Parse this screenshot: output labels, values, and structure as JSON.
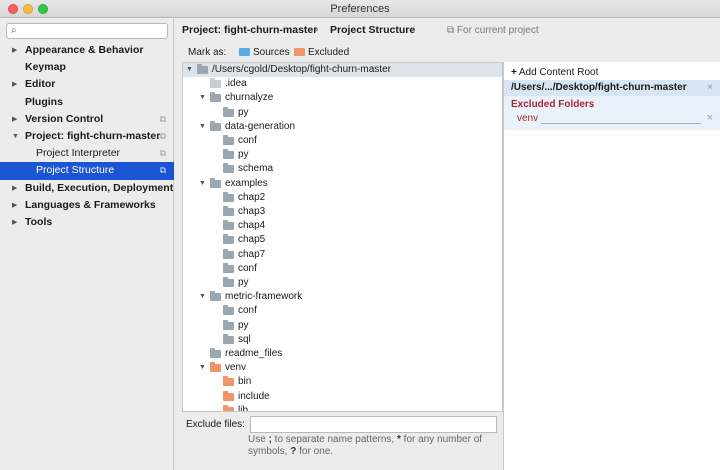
{
  "window": {
    "title": "Preferences"
  },
  "sidebar": {
    "search_placeholder": "",
    "items": [
      {
        "label": "Appearance & Behavior",
        "arrow": "▶",
        "copy": "",
        "sub": false,
        "selected": false
      },
      {
        "label": "Keymap",
        "arrow": "",
        "copy": "",
        "sub": false,
        "selected": false
      },
      {
        "label": "Editor",
        "arrow": "▶",
        "copy": "",
        "sub": false,
        "selected": false
      },
      {
        "label": "Plugins",
        "arrow": "",
        "copy": "",
        "sub": false,
        "selected": false
      },
      {
        "label": "Version Control",
        "arrow": "▶",
        "copy": "⧉",
        "sub": false,
        "selected": false
      },
      {
        "label": "Project: fight-churn-master",
        "arrow": "▼",
        "copy": "⧉",
        "sub": false,
        "selected": false
      },
      {
        "label": "Project Interpreter",
        "arrow": "",
        "copy": "⧉",
        "sub": true,
        "selected": false
      },
      {
        "label": "Project Structure",
        "arrow": "",
        "copy": "⧉",
        "sub": true,
        "selected": true
      },
      {
        "label": "Build, Execution, Deployment",
        "arrow": "▶",
        "copy": "",
        "sub": false,
        "selected": false
      },
      {
        "label": "Languages & Frameworks",
        "arrow": "▶",
        "copy": "",
        "sub": false,
        "selected": false
      },
      {
        "label": "Tools",
        "arrow": "▶",
        "copy": "",
        "sub": false,
        "selected": false
      }
    ]
  },
  "header": {
    "crumb_project": "Project: fight-churn-master",
    "separator": "›",
    "crumb_page": "Project Structure",
    "for_current": "For current project",
    "for_current_icon": "⧉"
  },
  "markas": {
    "label": "Mark as:",
    "sources": "Sources",
    "excluded": "Excluded",
    "sources_color": "#5aa9e6",
    "excluded_color": "#f0946a"
  },
  "tree": [
    {
      "label": "/Users/cgold/Desktop/fight-churn-master",
      "level": 0,
      "arrow": "▼",
      "type": "normal",
      "root": true
    },
    {
      "label": ".idea",
      "level": 1,
      "arrow": "",
      "type": "faint"
    },
    {
      "label": "churnalyze",
      "level": 1,
      "arrow": "▼",
      "type": "normal"
    },
    {
      "label": "py",
      "level": 2,
      "arrow": "",
      "type": "normal"
    },
    {
      "label": "data-generation",
      "level": 1,
      "arrow": "▼",
      "type": "normal"
    },
    {
      "label": "conf",
      "level": 2,
      "arrow": "",
      "type": "normal"
    },
    {
      "label": "py",
      "level": 2,
      "arrow": "",
      "type": "normal"
    },
    {
      "label": "schema",
      "level": 2,
      "arrow": "",
      "type": "normal"
    },
    {
      "label": "examples",
      "level": 1,
      "arrow": "▼",
      "type": "normal"
    },
    {
      "label": "chap2",
      "level": 2,
      "arrow": "",
      "type": "normal"
    },
    {
      "label": "chap3",
      "level": 2,
      "arrow": "",
      "type": "normal"
    },
    {
      "label": "chap4",
      "level": 2,
      "arrow": "",
      "type": "normal"
    },
    {
      "label": "chap5",
      "level": 2,
      "arrow": "",
      "type": "normal"
    },
    {
      "label": "chap7",
      "level": 2,
      "arrow": "",
      "type": "normal"
    },
    {
      "label": "conf",
      "level": 2,
      "arrow": "",
      "type": "normal"
    },
    {
      "label": "py",
      "level": 2,
      "arrow": "",
      "type": "normal"
    },
    {
      "label": "metric-framework",
      "level": 1,
      "arrow": "▼",
      "type": "normal"
    },
    {
      "label": "conf",
      "level": 2,
      "arrow": "",
      "type": "normal"
    },
    {
      "label": "py",
      "level": 2,
      "arrow": "",
      "type": "normal"
    },
    {
      "label": "sql",
      "level": 2,
      "arrow": "",
      "type": "normal"
    },
    {
      "label": "readme_files",
      "level": 1,
      "arrow": "",
      "type": "normal"
    },
    {
      "label": "venv",
      "level": 1,
      "arrow": "▼",
      "type": "excluded"
    },
    {
      "label": "bin",
      "level": 2,
      "arrow": "",
      "type": "excluded"
    },
    {
      "label": "include",
      "level": 2,
      "arrow": "",
      "type": "excluded"
    },
    {
      "label": "lib",
      "level": 2,
      "arrow": "",
      "type": "excluded"
    }
  ],
  "content_root": {
    "add_label": "Add Content Root",
    "add_icon": "+",
    "path": "/Users/.../Desktop/fight-churn-master",
    "remove_icon": "×",
    "excluded_title": "Excluded Folders",
    "excluded_items": [
      "venv"
    ]
  },
  "exclude_files": {
    "label": "Exclude files:",
    "value": "",
    "hint_1": "Use ",
    "hint_semicolon": ";",
    "hint_2": " to separate name patterns, ",
    "hint_star": "*",
    "hint_3": " for any number of symbols, ",
    "hint_q": "?",
    "hint_4": " for one."
  }
}
